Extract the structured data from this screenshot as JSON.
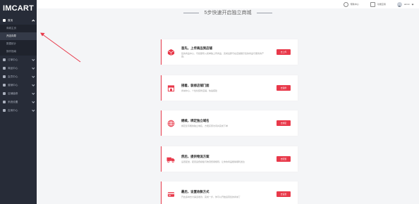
{
  "app": {
    "logo": "IMCART"
  },
  "sidebar": {
    "items": [
      {
        "label": "首页",
        "icon": "home-icon",
        "open": true,
        "children": [
          {
            "label": "商城主页",
            "active": false
          },
          {
            "label": "开店向导",
            "active": true
          },
          {
            "label": "数据统计",
            "active": false
          },
          {
            "label": "操作指南",
            "active": false
          }
        ]
      },
      {
        "label": "订单中心",
        "icon": "order-icon"
      },
      {
        "label": "商品中心",
        "icon": "goods-icon"
      },
      {
        "label": "会员中心",
        "icon": "member-icon"
      },
      {
        "label": "营销中心",
        "icon": "marketing-icon"
      },
      {
        "label": "店铺装修",
        "icon": "decor-icon"
      },
      {
        "label": "系统设置",
        "icon": "settings-icon"
      },
      {
        "label": "应用中心",
        "icon": "apps-icon"
      }
    ]
  },
  "topbar": {
    "help": "帮助中心",
    "msg": "功能应用",
    "user": "admin"
  },
  "main": {
    "heading": "5步快速开启独立商城",
    "steps": [
      {
        "title": "首先，上传商品到店铺",
        "desc": "您的商品中心，可批量导入和单独上传商品，完成后即可在店铺展示您的商品与服务的产品。",
        "button": "去上传",
        "icon": "box-icon"
      },
      {
        "title": "接着，装修店铺门面",
        "desc": "商城中心，个性化装修店铺，快速搭建",
        "button": "去装修",
        "icon": "store-icon"
      },
      {
        "title": "继续，绑定独立域名",
        "desc": "绑定您专属的独立域名，方便买家访问并完成下单",
        "button": "去绑定",
        "icon": "globe-icon"
      },
      {
        "title": "然后，提供物流方案",
        "desc": "设置配送，配置运费模板与物流费用规则，让你的商品能够顺利送达",
        "button": "去配置",
        "icon": "truck-icon"
      },
      {
        "title": "最后，设置收款方式",
        "desc": "开启多种支付渠道收款，完成一步，你可以开始运营您的商城了",
        "button": "去设置",
        "icon": "card-icon"
      }
    ]
  },
  "colors": {
    "accent": "#e8394a",
    "sidebar": "#272c38"
  }
}
